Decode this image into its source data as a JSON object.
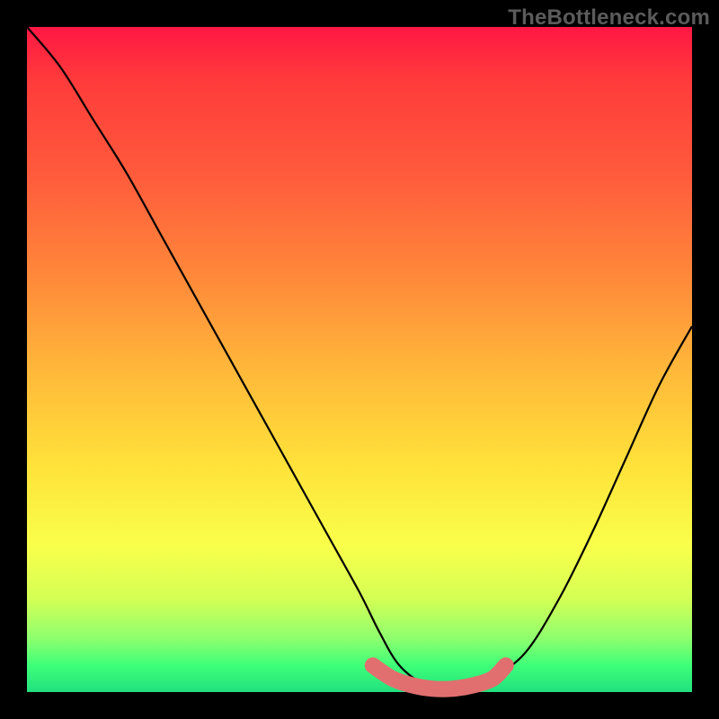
{
  "watermark": "TheBottleneck.com",
  "colors": {
    "page_bg": "#000000",
    "gradient_top": "#ff1744",
    "gradient_mid": "#ffe23a",
    "gradient_bottom": "#22e07f",
    "curve_stroke": "#000000",
    "ideal_marker": "#e16f6f",
    "watermark": "#5b5b5b"
  },
  "chart_data": {
    "type": "line",
    "title": "",
    "xlabel": "",
    "ylabel": "",
    "xlim": [
      0,
      100
    ],
    "ylim": [
      0,
      100
    ],
    "series": [
      {
        "name": "bottleneck-curve",
        "x": [
          0,
          5,
          10,
          15,
          20,
          25,
          30,
          35,
          40,
          45,
          50,
          53,
          56,
          60,
          64,
          68,
          70,
          75,
          80,
          85,
          90,
          95,
          100
        ],
        "y": [
          100,
          94,
          86,
          78,
          69,
          60,
          51,
          42,
          33,
          24,
          15,
          9,
          4,
          1,
          0,
          1,
          2,
          6,
          14,
          24,
          35,
          46,
          55
        ]
      },
      {
        "name": "ideal-zone-marker",
        "x": [
          52,
          55,
          58,
          61,
          64,
          67,
          70,
          72
        ],
        "y": [
          4,
          2,
          1,
          0.5,
          0.5,
          1,
          2,
          4
        ]
      }
    ],
    "annotations": []
  }
}
